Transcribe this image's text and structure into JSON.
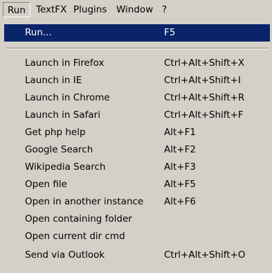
{
  "menubar": {
    "items": [
      {
        "label": "Run"
      },
      {
        "label": "TextFX"
      },
      {
        "label": "Plugins"
      },
      {
        "label": "Window"
      },
      {
        "label": "?"
      }
    ]
  },
  "run_menu": {
    "items": [
      {
        "label": "Run...",
        "shortcut": "F5"
      },
      {
        "label": "Launch in Firefox",
        "shortcut": "Ctrl+Alt+Shift+X"
      },
      {
        "label": "Launch in IE",
        "shortcut": "Ctrl+Alt+Shift+I"
      },
      {
        "label": "Launch in Chrome",
        "shortcut": "Ctrl+Alt+Shift+R"
      },
      {
        "label": "Launch in Safari",
        "shortcut": "Ctrl+Alt+Shift+F"
      },
      {
        "label": "Get php help",
        "shortcut": "Alt+F1"
      },
      {
        "label": "Google Search",
        "shortcut": "Alt+F2"
      },
      {
        "label": "Wikipedia Search",
        "shortcut": "Alt+F3"
      },
      {
        "label": "Open file",
        "shortcut": "Alt+F5"
      },
      {
        "label": "Open in another instance",
        "shortcut": "Alt+F6"
      },
      {
        "label": "Open containing folder",
        "shortcut": ""
      },
      {
        "label": "Open current dir cmd",
        "shortcut": ""
      },
      {
        "label": "Send via Outlook",
        "shortcut": "Ctrl+Alt+Shift+O"
      }
    ]
  },
  "colors": {
    "menu_background": "#d4d0c8",
    "highlight": "#0a246a",
    "highlight_text": "#ffffff"
  }
}
